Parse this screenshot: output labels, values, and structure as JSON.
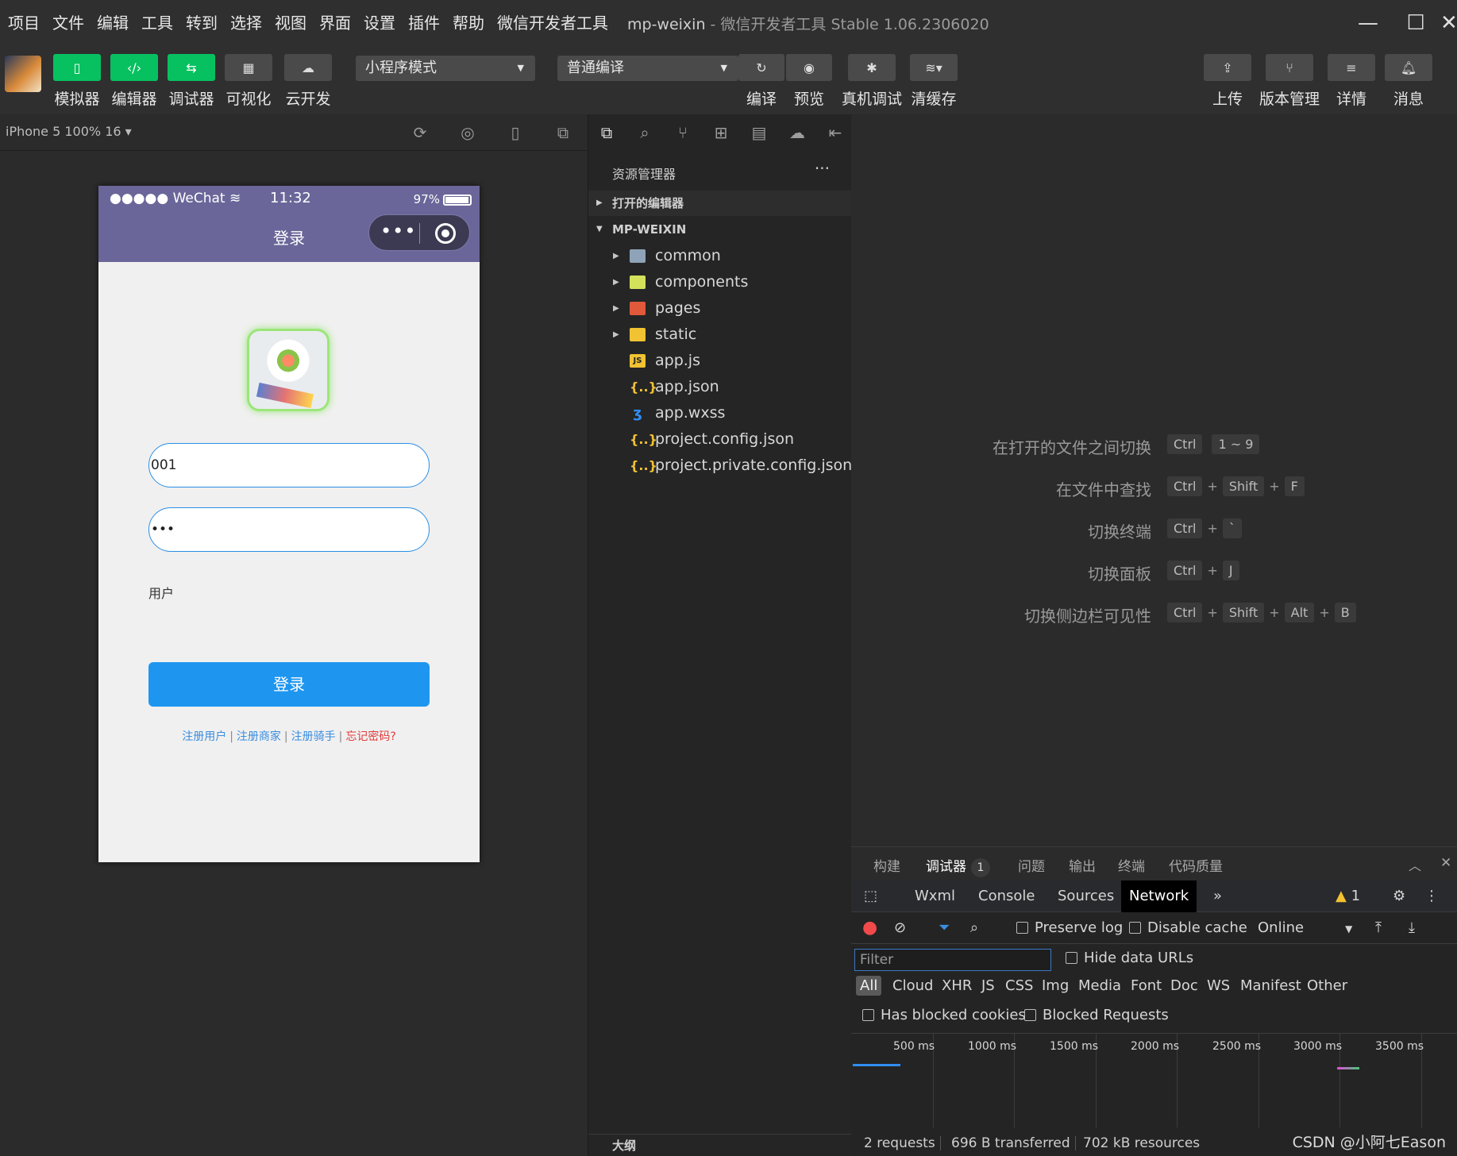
{
  "menu": {
    "items": [
      "项目",
      "文件",
      "编辑",
      "工具",
      "转到",
      "选择",
      "视图",
      "界面",
      "设置",
      "插件",
      "帮助",
      "微信开发者工具"
    ],
    "window_title": "mp-weixin",
    "window_subtitle": " - 微信开发者工具 Stable 1.06.2306020"
  },
  "toolbar": {
    "simulator": "模拟器",
    "editor": "编辑器",
    "debugger": "调试器",
    "visual": "可视化",
    "cloud": "云开发",
    "mode": "小程序模式",
    "compile_mode": "普通编译",
    "compile": "编译",
    "preview": "预览",
    "remote_debug": "真机调试",
    "clear_cache": "清缓存",
    "upload": "上传",
    "version": "版本管理",
    "details": "详情",
    "messages": "消息"
  },
  "simulator": {
    "device": "iPhone 5 100% 16 ▾"
  },
  "phone": {
    "carrier": "●●●●● WeChat",
    "time": "11:32",
    "battery": "97%",
    "page_title": "登录",
    "capsule_dots": "•••",
    "username_value": "001",
    "password_value": "•••",
    "role_label": "用户",
    "login_button": "登录",
    "links": {
      "register_user": "注册用户",
      "register_merchant": "注册商家",
      "register_rider": "注册骑手",
      "forgot": "忘记密码?",
      "sep": "|"
    }
  },
  "explorer": {
    "title": "资源管理器",
    "more": "···",
    "open_editors": "打开的编辑器",
    "project": "MP-WEIXIN",
    "files": [
      {
        "name": "common",
        "kind": "folder"
      },
      {
        "name": "components",
        "kind": "folder-g"
      },
      {
        "name": "pages",
        "kind": "folder-r"
      },
      {
        "name": "static",
        "kind": "folder-y"
      },
      {
        "name": "app.js",
        "kind": "js",
        "icon": "JS"
      },
      {
        "name": "app.json",
        "kind": "json",
        "icon": "{..}"
      },
      {
        "name": "app.wxss",
        "kind": "css",
        "icon": "ʒ"
      },
      {
        "name": "project.config.json",
        "kind": "json",
        "icon": "{..}"
      },
      {
        "name": "project.private.config.json",
        "kind": "json",
        "icon": "{..}"
      }
    ],
    "outline": "大纲"
  },
  "shortcuts": [
    {
      "label": "在打开的文件之间切换",
      "keys": [
        "Ctrl",
        "1 ~ 9"
      ],
      "joiners": [
        ""
      ]
    },
    {
      "label": "在文件中查找",
      "keys": [
        "Ctrl",
        "Shift",
        "F"
      ],
      "joiners": [
        "+",
        "+"
      ]
    },
    {
      "label": "切换终端",
      "keys": [
        "Ctrl",
        "`"
      ],
      "joiners": [
        "+"
      ]
    },
    {
      "label": "切换面板",
      "keys": [
        "Ctrl",
        "J"
      ],
      "joiners": [
        "+"
      ]
    },
    {
      "label": "切换侧边栏可见性",
      "keys": [
        "Ctrl",
        "Shift",
        "Alt",
        "B"
      ],
      "joiners": [
        "+",
        "+",
        "+"
      ]
    }
  ],
  "panel": {
    "tabs": {
      "build": "构建",
      "debugger": "调试器",
      "debugger_badge": "1",
      "problems": "问题",
      "output": "输出",
      "terminal": "终端",
      "quality": "代码质量"
    },
    "devtools_tabs": {
      "wxml": "Wxml",
      "console": "Console",
      "sources": "Sources",
      "network": "Network",
      "more": "»"
    },
    "warnings": "1",
    "network": {
      "preserve_log": "Preserve log",
      "disable_cache": "Disable cache",
      "throttle": "Online",
      "filter_placeholder": "Filter",
      "hide_data_urls": "Hide data URLs",
      "types": [
        "All",
        "Cloud",
        "XHR",
        "JS",
        "CSS",
        "Img",
        "Media",
        "Font",
        "Doc",
        "WS",
        "Manifest",
        "Other"
      ],
      "has_blocked_cookies": "Has blocked cookies",
      "blocked_requests": "Blocked Requests",
      "timeline": [
        "500 ms",
        "1000 ms",
        "1500 ms",
        "2000 ms",
        "2500 ms",
        "3000 ms",
        "3500 ms"
      ],
      "requests": "2 requests",
      "transferred": "696 B transferred",
      "resources": "702 kB resources"
    }
  },
  "watermark": "CSDN @小阿七Eason"
}
